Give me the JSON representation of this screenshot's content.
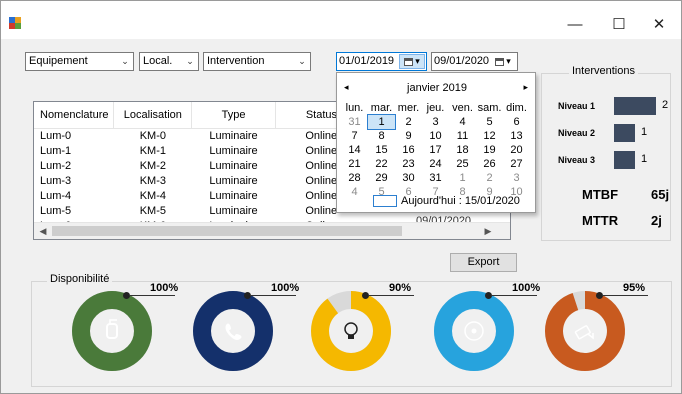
{
  "window": {
    "minimize_glyph": "—",
    "maximize_glyph": "☐",
    "close_glyph": "✕"
  },
  "filters": {
    "equipement": "Equipement",
    "localisation": "Local.",
    "intervention": "Intervention",
    "date_from": "01/01/2019",
    "date_to": "09/01/2020"
  },
  "calendar": {
    "month_label": "janvier 2019",
    "prev": "◂",
    "next": "▸",
    "weekdays": [
      "lun.",
      "mar.",
      "mer.",
      "jeu.",
      "ven.",
      "sam.",
      "dim."
    ],
    "weeks": [
      [
        "31",
        "1",
        "2",
        "3",
        "4",
        "5",
        "6"
      ],
      [
        "7",
        "8",
        "9",
        "10",
        "11",
        "12",
        "13"
      ],
      [
        "14",
        "15",
        "16",
        "17",
        "18",
        "19",
        "20"
      ],
      [
        "21",
        "22",
        "23",
        "24",
        "25",
        "26",
        "27"
      ],
      [
        "28",
        "29",
        "30",
        "31",
        "1",
        "2",
        "3"
      ],
      [
        "4",
        "5",
        "6",
        "7",
        "8",
        "9",
        "10"
      ]
    ],
    "today_label": "Aujourd'hui : 15/01/2020"
  },
  "table": {
    "columns": [
      "Nomenclature",
      "Localisation",
      "Type",
      "Status"
    ],
    "rows": [
      [
        "Lum-0",
        "KM-0",
        "Luminaire",
        "Online"
      ],
      [
        "Lum-1",
        "KM-1",
        "Luminaire",
        "Online"
      ],
      [
        "Lum-2",
        "KM-2",
        "Luminaire",
        "Online"
      ],
      [
        "Lum-3",
        "KM-3",
        "Luminaire",
        "Online"
      ],
      [
        "Lum-4",
        "KM-4",
        "Luminaire",
        "Online"
      ],
      [
        "Lum-5",
        "KM-5",
        "Luminaire",
        "Online"
      ],
      [
        "Lum-6",
        "KM-6",
        "Luminaire",
        "Online"
      ]
    ],
    "partial_date": "09/01/2020"
  },
  "interventions": {
    "title": "Interventions",
    "levels": [
      {
        "label": "Niveau 1",
        "value": "2",
        "count": 2
      },
      {
        "label": "Niveau 2",
        "value": "1",
        "count": 1
      },
      {
        "label": "Niveau 3",
        "value": "1",
        "count": 1
      }
    ],
    "bar_color": "#3c4a60",
    "mtbf_label": "MTBF",
    "mtbf_value": "65j",
    "mttr_label": "MTTR",
    "mttr_value": "2j"
  },
  "export_label": "Export",
  "availability": {
    "title": "Disponibilité",
    "gauges": [
      {
        "pct_label": "100%",
        "fraction": 1.0,
        "color": "#4a7a3a",
        "icon": "fire-extinguisher-icon"
      },
      {
        "pct_label": "100%",
        "fraction": 1.0,
        "color": "#14306b",
        "icon": "phone-icon"
      },
      {
        "pct_label": "90%",
        "fraction": 0.9,
        "color": "#f5b800",
        "icon": "lightbulb-icon"
      },
      {
        "pct_label": "100%",
        "fraction": 1.0,
        "color": "#27a3dd",
        "icon": "fan-icon"
      },
      {
        "pct_label": "95%",
        "fraction": 0.95,
        "color": "#c85a1f",
        "icon": "camera-icon"
      }
    ]
  }
}
